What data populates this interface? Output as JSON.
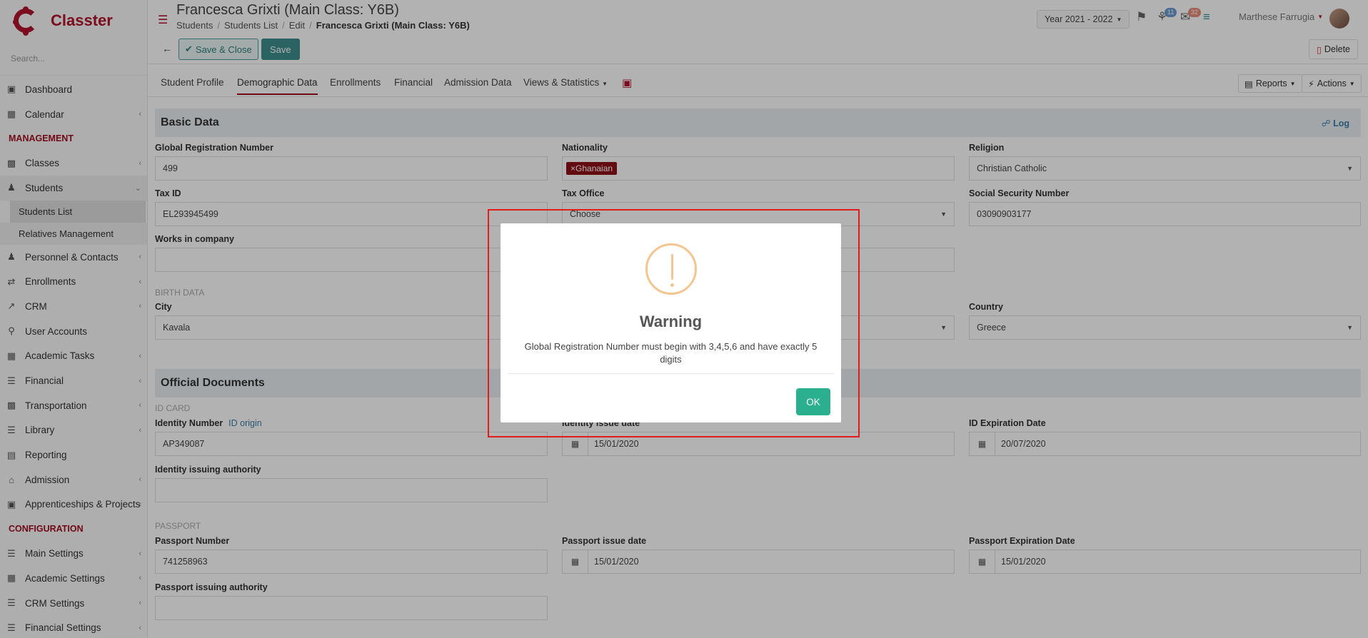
{
  "app": {
    "name": "Classter"
  },
  "sidebar": {
    "search_placeholder": "Search...",
    "items": [
      {
        "label": "Dashboard",
        "icon": "laptop-icon"
      },
      {
        "label": "Calendar",
        "icon": "calendar-icon"
      }
    ],
    "management_label": "MANAGEMENT",
    "management_items": [
      {
        "label": "Classes"
      },
      {
        "label": "Students"
      }
    ],
    "students_sub": [
      {
        "label": "Students List"
      },
      {
        "label": "Relatives Management"
      }
    ],
    "more_items": [
      {
        "label": "Personnel & Contacts"
      },
      {
        "label": "Enrollments"
      },
      {
        "label": "CRM"
      },
      {
        "label": "User Accounts"
      },
      {
        "label": "Academic Tasks"
      },
      {
        "label": "Financial"
      },
      {
        "label": "Transportation"
      },
      {
        "label": "Library"
      },
      {
        "label": "Reporting"
      },
      {
        "label": "Admission"
      },
      {
        "label": "Apprenticeships & Projects"
      }
    ],
    "configuration_label": "CONFIGURATION",
    "config_items": [
      {
        "label": "Main Settings"
      },
      {
        "label": "Academic Settings"
      },
      {
        "label": "CRM Settings"
      },
      {
        "label": "Financial Settings"
      }
    ]
  },
  "header": {
    "title": "Francesca Grixti (Main Class: Y6B)",
    "breadcrumb": [
      "Students",
      "Students List",
      "Edit",
      "Francesca Grixti (Main Class: Y6B)"
    ],
    "year": "Year 2021 - 2022",
    "notifications_count": "11",
    "messages_count": "32",
    "user_name": "Marthese Farrugia"
  },
  "toolbar": {
    "save_close": "Save & Close",
    "save": "Save",
    "delete": "Delete"
  },
  "tabs": [
    "Student Profile",
    "Demographic Data",
    "Enrollments",
    "Financial",
    "Admission Data",
    "Views & Statistics"
  ],
  "tab_actions": {
    "reports": "Reports",
    "actions": "Actions"
  },
  "basic": {
    "title": "Basic Data",
    "log": "Log",
    "global_reg_label": "Global Registration Number",
    "global_reg_value": "499",
    "nationality_label": "Nationality",
    "nationality_tag": "Ghanaian",
    "religion_label": "Religion",
    "religion_value": "Christian Catholic",
    "tax_id_label": "Tax ID",
    "tax_id_value": "EL293945499",
    "tax_office_label": "Tax Office",
    "tax_office_value": "Choose",
    "ssn_label": "Social Security Number",
    "ssn_value": "03090903177",
    "works_label": "Works in company",
    "birth_head": "BIRTH DATA",
    "city_label": "City",
    "city_value": "Kavala",
    "country_label": "Country",
    "country_value": "Greece"
  },
  "official": {
    "title": "Official Documents",
    "id_card_head": "ID CARD",
    "id_number_label": "Identity Number",
    "id_origin": "ID origin",
    "id_number_value": "AP349087",
    "id_issue_label": "Identity issue date",
    "id_issue_value": "15/01/2020",
    "id_exp_label": "ID Expiration Date",
    "id_exp_value": "20/07/2020",
    "id_authority_label": "Identity issuing authority",
    "passport_head": "PASSPORT",
    "passport_number_label": "Passport Number",
    "passport_number_value": "741258963",
    "passport_issue_label": "Passport issue date",
    "passport_issue_value": "15/01/2020",
    "passport_exp_label": "Passport Expiration Date",
    "passport_exp_value": "15/01/2020",
    "passport_authority_label": "Passport issuing authority"
  },
  "modal": {
    "title": "Warning",
    "message": "Global Registration Number must begin with 3,4,5,6 and have exactly 5 digits",
    "ok": "OK"
  }
}
